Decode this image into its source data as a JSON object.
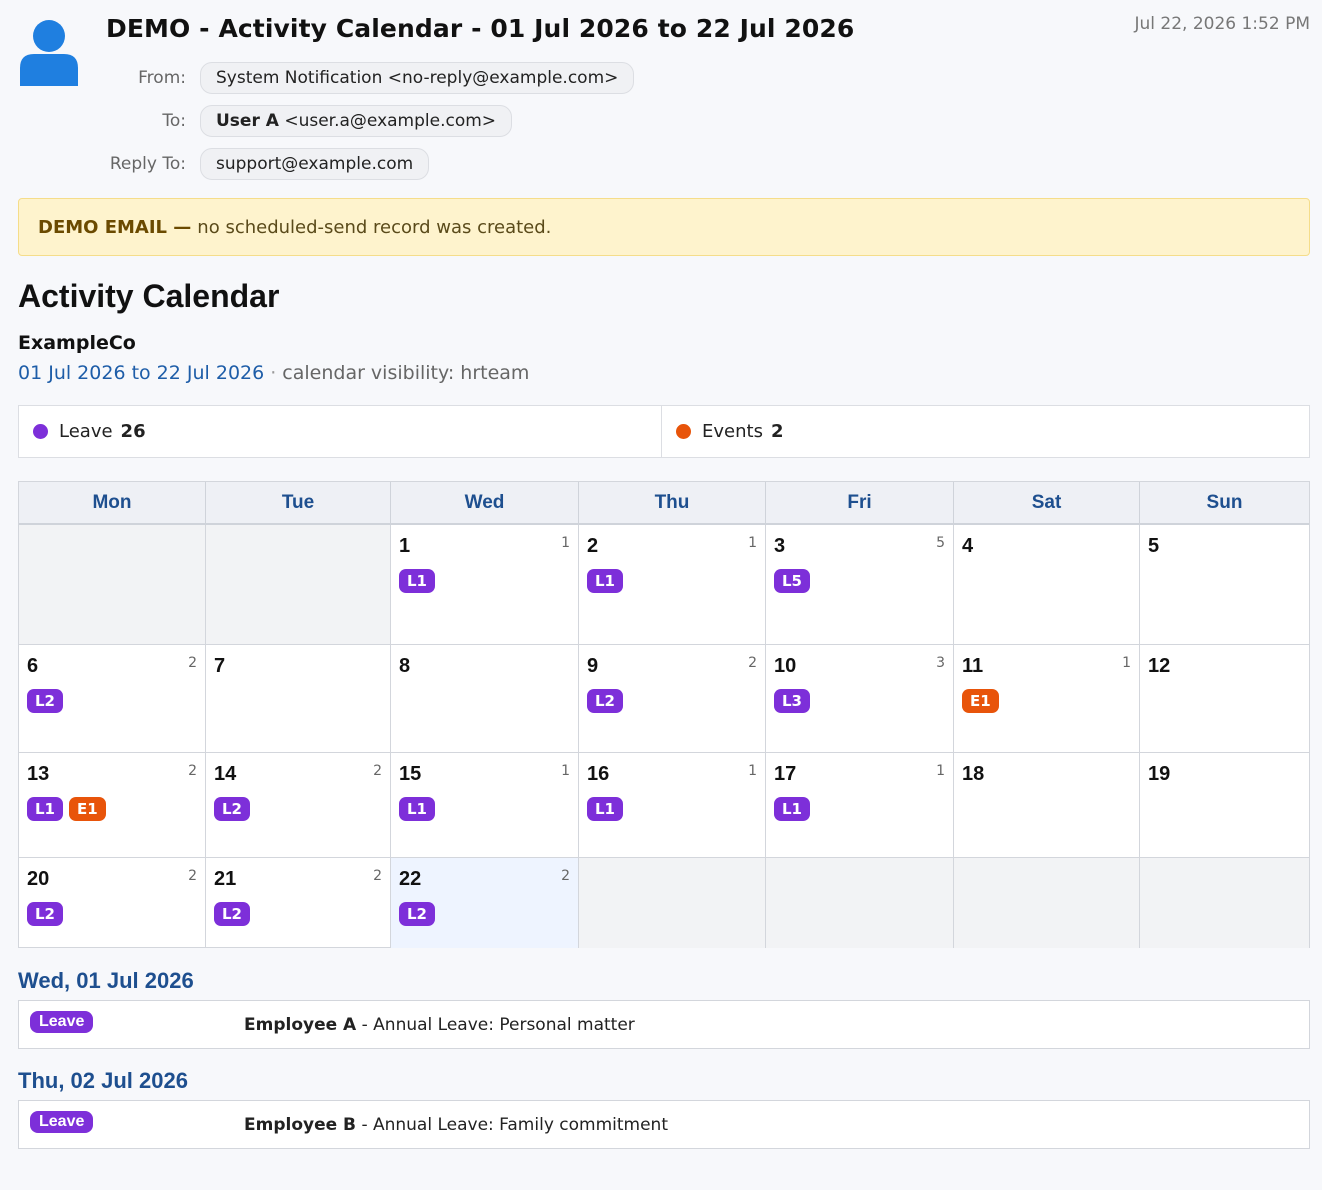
{
  "email": {
    "subject": "DEMO - Activity Calendar - 01 Jul 2026 to 22 Jul 2026",
    "date": "Jul 22, 2026 1:52 PM",
    "from_label": "From:",
    "from_value": "System Notification <no-reply@example.com>",
    "to_label": "To:",
    "to_name": "User A",
    "to_email": "<user.a@example.com>",
    "reply_label": "Reply To:",
    "reply_value": "support@example.com"
  },
  "banner": {
    "strong": "DEMO EMAIL —",
    "text": "no scheduled-send record was created."
  },
  "calendar": {
    "title": "Activity Calendar",
    "company": "ExampleCo",
    "range": "01 Jul 2026 to 22 Jul 2026",
    "separator": "·",
    "visibility": "calendar visibility: hrteam",
    "summary": [
      {
        "label": "Leave",
        "count": "26",
        "color": "#7d2fd9"
      },
      {
        "label": "Events",
        "count": "2",
        "color": "#e8540a"
      }
    ],
    "weekdays": [
      "Mon",
      "Tue",
      "Wed",
      "Thu",
      "Fri",
      "Sat",
      "Sun"
    ],
    "weeks": [
      [
        {
          "empty": true
        },
        {
          "empty": true
        },
        {
          "day": "1",
          "count": "1",
          "badges": [
            {
              "t": "L1",
              "k": "leave"
            }
          ]
        },
        {
          "day": "2",
          "count": "1",
          "badges": [
            {
              "t": "L1",
              "k": "leave"
            }
          ]
        },
        {
          "day": "3",
          "count": "5",
          "badges": [
            {
              "t": "L5",
              "k": "leave"
            }
          ]
        },
        {
          "day": "4",
          "count": "",
          "badges": []
        },
        {
          "day": "5",
          "count": "",
          "badges": []
        }
      ],
      [
        {
          "day": "6",
          "count": "2",
          "badges": [
            {
              "t": "L2",
              "k": "leave"
            }
          ]
        },
        {
          "day": "7",
          "count": "",
          "badges": []
        },
        {
          "day": "8",
          "count": "",
          "badges": []
        },
        {
          "day": "9",
          "count": "2",
          "badges": [
            {
              "t": "L2",
              "k": "leave"
            }
          ]
        },
        {
          "day": "10",
          "count": "3",
          "badges": [
            {
              "t": "L3",
              "k": "leave"
            }
          ]
        },
        {
          "day": "11",
          "count": "1",
          "badges": [
            {
              "t": "E1",
              "k": "event"
            }
          ]
        },
        {
          "day": "12",
          "count": "",
          "badges": []
        }
      ],
      [
        {
          "day": "13",
          "count": "2",
          "badges": [
            {
              "t": "L1",
              "k": "leave"
            },
            {
              "t": "E1",
              "k": "event"
            }
          ]
        },
        {
          "day": "14",
          "count": "2",
          "badges": [
            {
              "t": "L2",
              "k": "leave"
            }
          ]
        },
        {
          "day": "15",
          "count": "1",
          "badges": [
            {
              "t": "L1",
              "k": "leave"
            }
          ]
        },
        {
          "day": "16",
          "count": "1",
          "badges": [
            {
              "t": "L1",
              "k": "leave"
            }
          ]
        },
        {
          "day": "17",
          "count": "1",
          "badges": [
            {
              "t": "L1",
              "k": "leave"
            }
          ]
        },
        {
          "day": "18",
          "count": "",
          "badges": []
        },
        {
          "day": "19",
          "count": "",
          "badges": []
        }
      ],
      [
        {
          "day": "20",
          "count": "2",
          "badges": [
            {
              "t": "L2",
              "k": "leave"
            }
          ]
        },
        {
          "day": "21",
          "count": "2",
          "badges": [
            {
              "t": "L2",
              "k": "leave"
            }
          ]
        },
        {
          "day": "22",
          "count": "2",
          "today": true,
          "badges": [
            {
              "t": "L2",
              "k": "leave"
            }
          ]
        },
        {
          "empty": true
        },
        {
          "empty": true
        },
        {
          "empty": true
        },
        {
          "empty": true
        }
      ]
    ]
  },
  "details": [
    {
      "heading": "Wed, 01 Jul 2026",
      "tag": "Leave",
      "who": "Employee A",
      "text": "- Annual Leave: Personal matter"
    },
    {
      "heading": "Thu, 02 Jul 2026",
      "tag": "Leave",
      "who": "Employee B",
      "text": "- Annual Leave: Family commitment"
    }
  ]
}
